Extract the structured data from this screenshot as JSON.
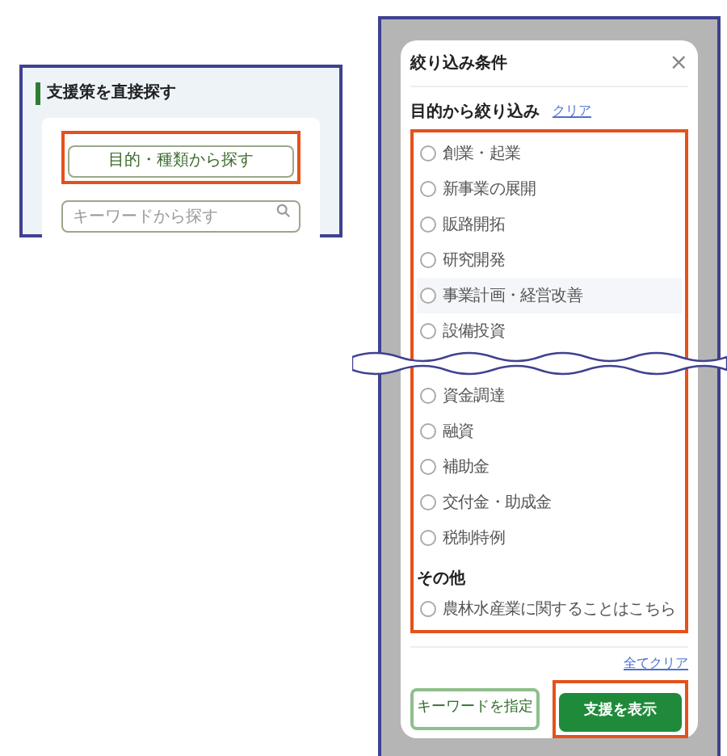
{
  "left_panel": {
    "title": "支援策を直接探す",
    "purpose_button": "目的・種類から探す",
    "search": {
      "placeholder": "キーワードから探す"
    }
  },
  "modal": {
    "title": "絞り込み条件",
    "close": "×",
    "purpose_section": {
      "title": "目的から絞り込み",
      "clear_link": "クリア",
      "options": [
        {
          "label": "創業・起業",
          "checked": false
        },
        {
          "label": "新事業の展開",
          "checked": false
        },
        {
          "label": "販路開拓",
          "checked": false
        },
        {
          "label": "研究開発",
          "checked": false
        },
        {
          "label": "事業計画・経営改善",
          "checked": false
        },
        {
          "label": "設備投資",
          "checked": false
        },
        {
          "label": "資金調達",
          "checked": false
        },
        {
          "label": "融資",
          "checked": false
        },
        {
          "label": "補助金",
          "checked": false
        },
        {
          "label": "交付金・助成金",
          "checked": false
        },
        {
          "label": "税制特例",
          "checked": false
        }
      ]
    },
    "other_section": {
      "title": "その他",
      "options": [
        {
          "label": "農林水産業に関することはこちら",
          "checked": false
        }
      ]
    },
    "clear_all_link": "全てクリア",
    "keyword_button": "キーワードを指定",
    "show_button": "支援を表示"
  }
}
